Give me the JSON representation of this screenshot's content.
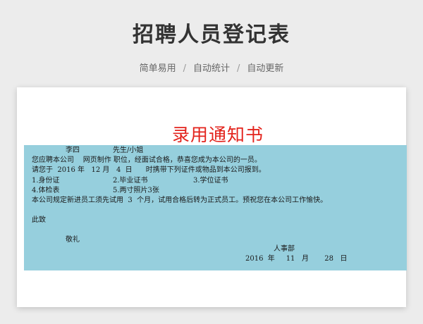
{
  "header": {
    "title": "招聘人员登记表",
    "tags": [
      "简单易用",
      "自动统计",
      "自动更新"
    ],
    "separator": "/"
  },
  "letter": {
    "title": "录用通知书",
    "name": "李四",
    "salutation": "先生/小姐",
    "line_offer": "您应聘本公司    网页制作 职位，经面试合格，恭喜您成为本公司的一员。",
    "line_report": "请您于  2016 年   12 月   4  日      时携带下列证件或物品到本公司报到。",
    "items_row1": [
      "1.身份证",
      "2.毕业证书",
      "3.学位证书"
    ],
    "items_row2": [
      "4.体检表",
      "5.两寸照片3张"
    ],
    "line_probation": "本公司规定新进员工须先试用  3  个月，试用合格后转为正式员工。预祝您在本公司工作愉快。",
    "closing": "此致",
    "regards": "敬礼",
    "department": "人事部",
    "signoff_date": "2016  年     11   月       28   日"
  }
}
